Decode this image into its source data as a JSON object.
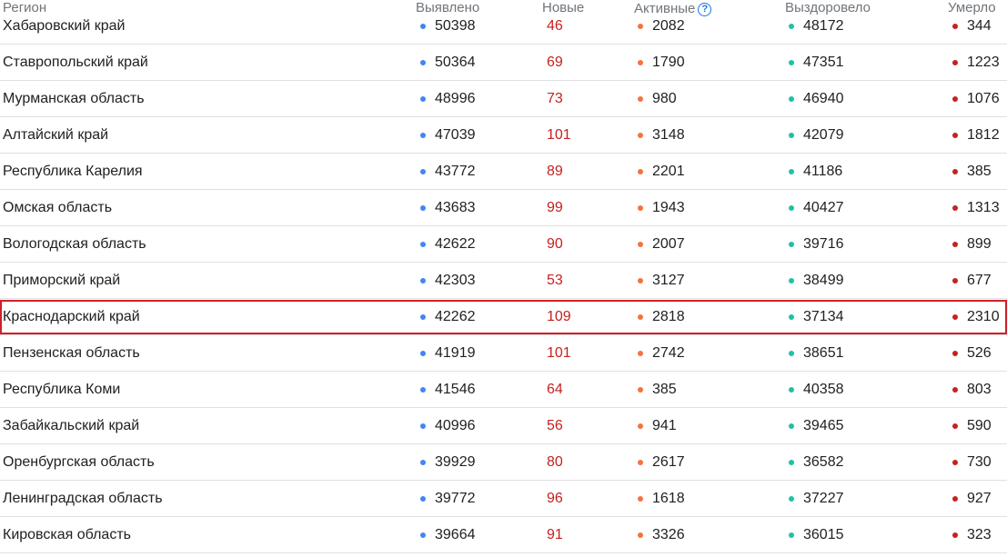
{
  "header": {
    "region": "Регион",
    "detected": "Выявлено",
    "new": "Новые",
    "active": "Активные",
    "active_help": "?",
    "recovered": "Выздоровело",
    "died": "Умерло"
  },
  "colors": {
    "detected_dot": "#4285f4",
    "new_text": "#c5221f",
    "active_dot": "#f4733d",
    "recovered_dot": "#1ec2a3",
    "died_dot": "#c5221f",
    "highlight_border": "#d21f26"
  },
  "rows": [
    {
      "region": "Хабаровский край",
      "detected": "50398",
      "new": "46",
      "active": "2082",
      "recovered": "48172",
      "died": "344"
    },
    {
      "region": "Ставропольский край",
      "detected": "50364",
      "new": "69",
      "active": "1790",
      "recovered": "47351",
      "died": "1223"
    },
    {
      "region": "Мурманская область",
      "detected": "48996",
      "new": "73",
      "active": "980",
      "recovered": "46940",
      "died": "1076"
    },
    {
      "region": "Алтайский край",
      "detected": "47039",
      "new": "101",
      "active": "3148",
      "recovered": "42079",
      "died": "1812"
    },
    {
      "region": "Республика Карелия",
      "detected": "43772",
      "new": "89",
      "active": "2201",
      "recovered": "41186",
      "died": "385"
    },
    {
      "region": "Омская область",
      "detected": "43683",
      "new": "99",
      "active": "1943",
      "recovered": "40427",
      "died": "1313"
    },
    {
      "region": "Вологодская область",
      "detected": "42622",
      "new": "90",
      "active": "2007",
      "recovered": "39716",
      "died": "899"
    },
    {
      "region": "Приморский край",
      "detected": "42303",
      "new": "53",
      "active": "3127",
      "recovered": "38499",
      "died": "677"
    },
    {
      "region": "Краснодарский край",
      "detected": "42262",
      "new": "109",
      "active": "2818",
      "recovered": "37134",
      "died": "2310",
      "highlighted": true
    },
    {
      "region": "Пензенская область",
      "detected": "41919",
      "new": "101",
      "active": "2742",
      "recovered": "38651",
      "died": "526"
    },
    {
      "region": "Республика Коми",
      "detected": "41546",
      "new": "64",
      "active": "385",
      "recovered": "40358",
      "died": "803"
    },
    {
      "region": "Забайкальский край",
      "detected": "40996",
      "new": "56",
      "active": "941",
      "recovered": "39465",
      "died": "590"
    },
    {
      "region": "Оренбургская область",
      "detected": "39929",
      "new": "80",
      "active": "2617",
      "recovered": "36582",
      "died": "730"
    },
    {
      "region": "Ленинградская область",
      "detected": "39772",
      "new": "96",
      "active": "1618",
      "recovered": "37227",
      "died": "927"
    },
    {
      "region": "Кировская область",
      "detected": "39664",
      "new": "91",
      "active": "3326",
      "recovered": "36015",
      "died": "323"
    }
  ]
}
